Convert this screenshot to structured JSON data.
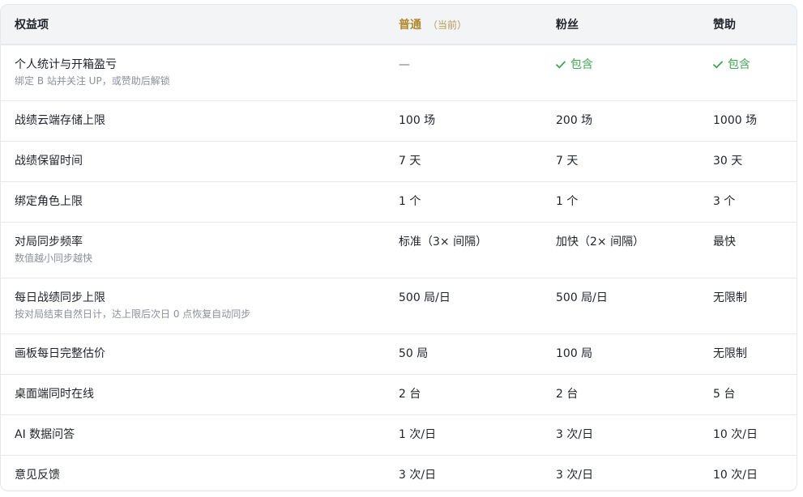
{
  "header": {
    "feature": "权益项",
    "standard": "普通",
    "current_tag": "（当前）",
    "fan": "粉丝",
    "sponsor": "赞助"
  },
  "rows": [
    {
      "title": "个人统计与开箱盈亏",
      "subtitle": "绑定 B 站并关注 UP，或赞助后解锁",
      "standard": "—",
      "fan": "包含",
      "sponsor": "包含"
    },
    {
      "title": "战绩云端存储上限",
      "standard": "100 场",
      "fan": "200 场",
      "sponsor": "1000 场"
    },
    {
      "title": "战绩保留时间",
      "standard": "7 天",
      "fan": "7 天",
      "sponsor": "30 天"
    },
    {
      "title": "绑定角色上限",
      "standard": "1 个",
      "fan": "1 个",
      "sponsor": "3 个"
    },
    {
      "title": "对局同步频率",
      "subtitle": "数值越小同步越快",
      "standard": "标准（3× 间隔）",
      "fan": "加快（2× 间隔）",
      "sponsor": "最快"
    },
    {
      "title": "每日战绩同步上限",
      "subtitle": "按对局结束自然日计，达上限后次日 0 点恢复自动同步",
      "standard": "500 局/日",
      "fan": "500 局/日",
      "sponsor": "无限制"
    },
    {
      "title": "画板每日完整估价",
      "standard": "50 局",
      "fan": "100 局",
      "sponsor": "无限制"
    },
    {
      "title": "桌面端同时在线",
      "standard": "2 台",
      "fan": "2 台",
      "sponsor": "5 台"
    },
    {
      "title": "AI 数据问答",
      "standard": "1 次/日",
      "fan": "3 次/日",
      "sponsor": "10 次/日"
    },
    {
      "title": "意见反馈",
      "standard": "3 次/日",
      "fan": "3 次/日",
      "sponsor": "10 次/日"
    }
  ],
  "icons": {
    "included": "check-icon"
  },
  "colors": {
    "header_bg": "#f3f4f6",
    "current_tier": "#b08a2e",
    "included": "#3fa752",
    "subtext": "#8a9099",
    "border": "#e6e8eb"
  }
}
